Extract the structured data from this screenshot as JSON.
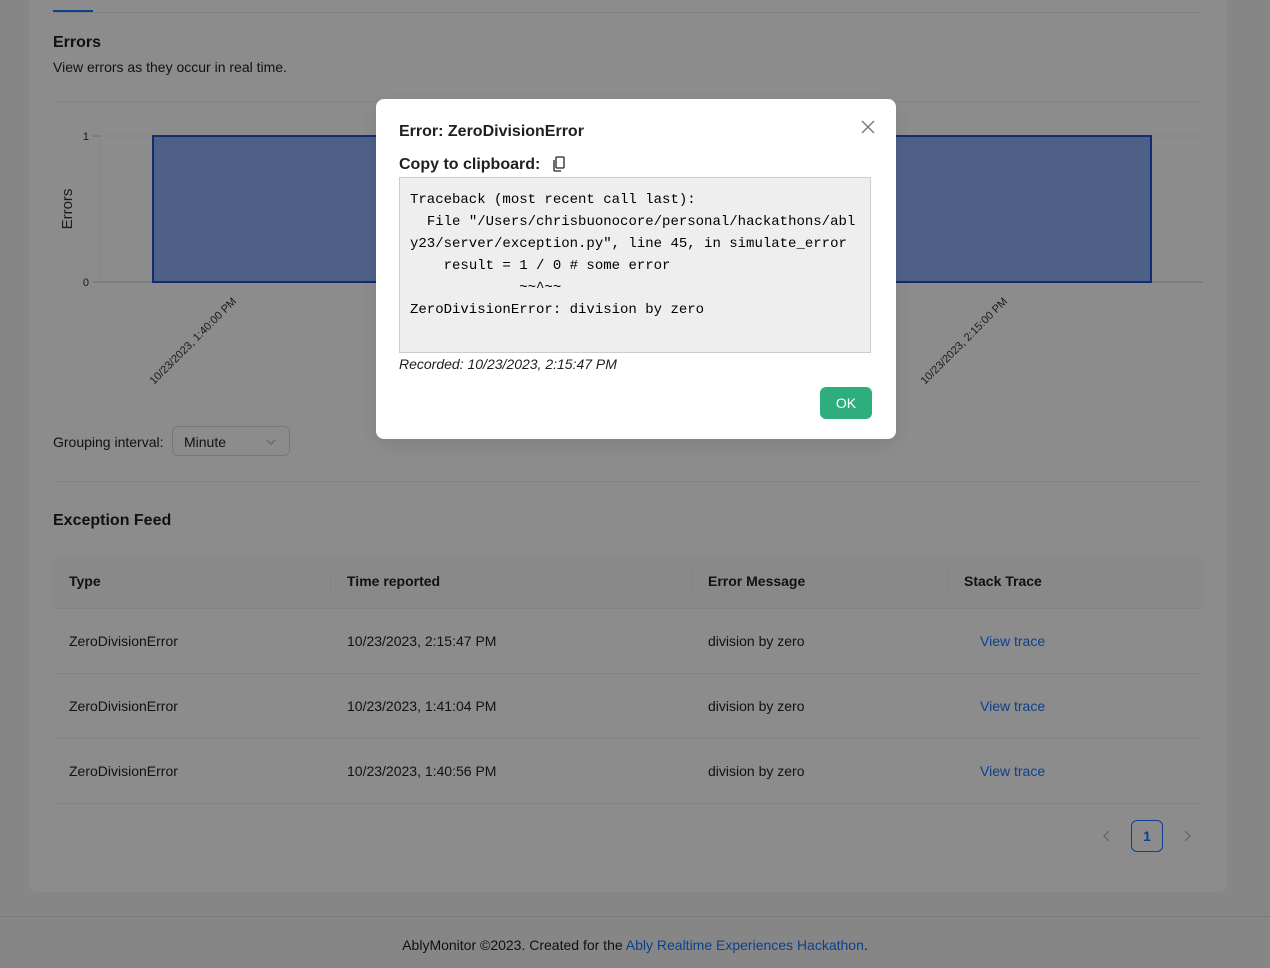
{
  "errors_section": {
    "title": "Errors",
    "description": "View errors as they occur in real time."
  },
  "chart_data": {
    "type": "area",
    "ylabel": "Errors",
    "yticks": [
      "1",
      "0"
    ],
    "ylim": [
      0,
      1
    ],
    "x_ticks": [
      "10/23/2023, 1:40:00 PM",
      "10/23/2023, 2:15:00 PM"
    ],
    "series": [
      {
        "x": [
          "10/23/2023, 1:40:00 PM",
          "10/23/2023, 2:15:00 PM"
        ],
        "values": [
          1,
          1
        ]
      }
    ],
    "fill_color": "#8fb0f5",
    "stroke_color": "#1f4fd6"
  },
  "grouping": {
    "label": "Grouping interval:",
    "selected": "Minute"
  },
  "feed": {
    "title": "Exception Feed",
    "columns": [
      "Type",
      "Time reported",
      "Error Message",
      "Stack Trace"
    ],
    "rows": [
      {
        "type": "ZeroDivisionError",
        "time": "10/23/2023, 2:15:47 PM",
        "message": "division by zero",
        "action": "View trace"
      },
      {
        "type": "ZeroDivisionError",
        "time": "10/23/2023, 1:41:04 PM",
        "message": "division by zero",
        "action": "View trace"
      },
      {
        "type": "ZeroDivisionError",
        "time": "10/23/2023, 1:40:56 PM",
        "message": "division by zero",
        "action": "View trace"
      }
    ]
  },
  "pagination": {
    "current": "1"
  },
  "footer": {
    "text": "AblyMonitor ©2023. Created for the ",
    "link": "Ably Realtime Experiences Hackathon",
    "suffix": "."
  },
  "modal": {
    "title": "Error: ZeroDivisionError",
    "copy_label": "Copy to clipboard:",
    "copy_icon": "copy-icon",
    "trace": "Traceback (most recent call last):\n  File \"/Users/chrisbuonocore/personal/hackathons/ably23/server/exception.py\", line 45, in simulate_error\n    result = 1 / 0 # some error\n             ~~^~~\nZeroDivisionError: division by zero",
    "recorded": "Recorded: 10/23/2023, 2:15:47 PM",
    "ok_label": "OK"
  },
  "colors": {
    "accent": "#1677ff",
    "ok_button": "#2fae7d"
  }
}
